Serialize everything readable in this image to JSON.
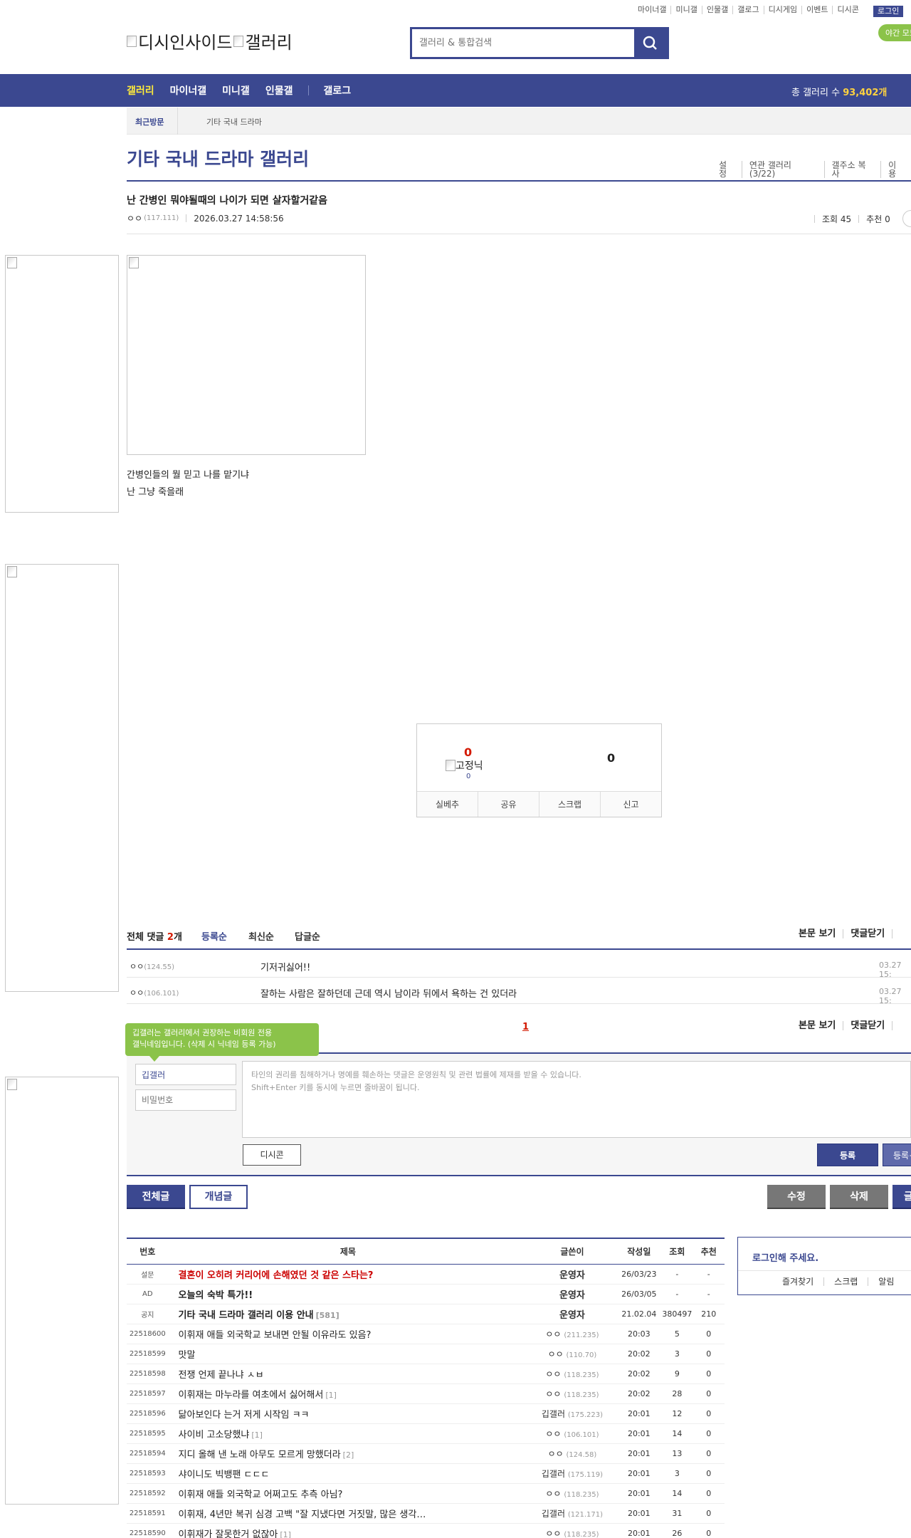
{
  "topnav": {
    "items": [
      "마이너갤",
      "미니갤",
      "인물갤",
      "갤로그",
      "디시게임",
      "이벤트",
      "디시콘"
    ],
    "login_label": "로그인",
    "night_mode_label": "야간 모드"
  },
  "logo": {
    "site_alt": "디시인사이드",
    "gallery_alt": "갤러리"
  },
  "search": {
    "placeholder": "갤러리 & 통합검색"
  },
  "main_nav": {
    "items": [
      "갤러리",
      "마이너갤",
      "미니갤",
      "인물갤",
      "갤로그"
    ],
    "active_index": 0,
    "gallery_count_label": "총 갤러리 수",
    "gallery_count_value": "93,402개"
  },
  "recent": {
    "label": "최근방문",
    "item": "기타 국내 드라마"
  },
  "gallery": {
    "title": "기타 국내 드라마 갤러리",
    "tools": [
      "설정",
      "연관 갤러리(3/22)",
      "갤주소 복사",
      "이용"
    ]
  },
  "post": {
    "title": "난 간병인 뭐야될때의 나이가 되면 살자할거같음",
    "author": "ㅇㅇ",
    "author_ip": "(117.111)",
    "datetime": "2026.03.27 14:58:56",
    "views_label": "조회 45",
    "recommend_label": "추천 0",
    "body_lines": [
      "간병인들의 뭘 믿고 나를 맡기냐",
      "난 그냥 죽을래"
    ]
  },
  "recommend_box": {
    "up_count": "0",
    "fixed_nick_alt": "고정닉",
    "fixed_nick_count": "0",
    "down_count": "0",
    "actions": [
      "실베추",
      "공유",
      "스크랩",
      "신고"
    ]
  },
  "comments": {
    "total_label": "전체 댓글",
    "total_count": "2",
    "total_unit": "개",
    "sorts": [
      "등록순",
      "최신순",
      "답글순"
    ],
    "right_links": [
      "본문 보기",
      "댓글닫기"
    ],
    "items": [
      {
        "nick": "ㅇㅇ",
        "ip": "(124.55)",
        "text": "기저귀싫어!!",
        "date": "03.27 15:"
      },
      {
        "nick": "ㅇㅇ",
        "ip": "(106.101)",
        "text": "잘하는 사람은 잘하던데 근데 역시 남이라 뒤에서 욕하는 건 있더라",
        "date": "03.27 15:"
      }
    ],
    "page": "1"
  },
  "write": {
    "tooltip_line1": "깁갤러는 갤러리에서 권장하는 비회원 전용",
    "tooltip_line2": "갤닉네임입니다. (삭제 시 닉네임 등록 가능)",
    "nick_value": "깁갤러",
    "password_placeholder": "비밀번호",
    "textarea_line1": "타인의 권리를 침해하거나 명예를 훼손하는 댓글은 운영원칙 및 관련 법률에 제재를 받을 수 있습니다.",
    "textarea_line2": "Shift+Enter 키를 동시에 누르면 줄바꿈이 됩니다.",
    "dccon_label": "디시콘",
    "submit_label": "등록",
    "submit2_label": "등록+"
  },
  "list_buttons": {
    "all": "전체글",
    "best": "개념글",
    "edit": "수정",
    "delete": "삭제",
    "write": "글쓰기"
  },
  "list": {
    "headers": [
      "번호",
      "제목",
      "글쓴이",
      "작성일",
      "조회",
      "추천"
    ],
    "rows": [
      {
        "num": "설문",
        "subject": "결혼이 오히려 커리어에 손해였던 것 같은 스타는?",
        "reply": "",
        "writer": "운영자",
        "ip": "",
        "date": "26/03/23",
        "views": "-",
        "rec": "-",
        "style": "red",
        "writer_bold": true
      },
      {
        "num": "AD",
        "subject": "오늘의 숙박 특가!!",
        "reply": "",
        "writer": "운영자",
        "ip": "",
        "date": "26/03/05",
        "views": "-",
        "rec": "-",
        "style": "notice",
        "writer_bold": true
      },
      {
        "num": "공지",
        "subject": "기타 국내 드라마 갤러리 이용 안내",
        "reply": "[581]",
        "writer": "운영자",
        "ip": "",
        "date": "21.02.04",
        "views": "380497",
        "rec": "210",
        "style": "notice",
        "writer_bold": true
      },
      {
        "num": "22518600",
        "subject": "이휘재 애들 외국학교 보내면 안될 이유라도 있음?",
        "reply": "",
        "writer": "ㅇㅇ",
        "ip": "(211.235)",
        "date": "20:03",
        "views": "5",
        "rec": "0",
        "style": "",
        "writer_bold": false
      },
      {
        "num": "22518599",
        "subject": "맛말",
        "reply": "",
        "writer": "ㅇㅇ",
        "ip": "(110.70)",
        "date": "20:02",
        "views": "3",
        "rec": "0",
        "style": "",
        "writer_bold": false
      },
      {
        "num": "22518598",
        "subject": "전쟁 언제 끝나냐 ㅅㅂ",
        "reply": "",
        "writer": "ㅇㅇ",
        "ip": "(118.235)",
        "date": "20:02",
        "views": "9",
        "rec": "0",
        "style": "",
        "writer_bold": false
      },
      {
        "num": "22518597",
        "subject": "이휘재는 마누라를 여초에서 싫어해서",
        "reply": "[1]",
        "writer": "ㅇㅇ",
        "ip": "(118.235)",
        "date": "20:02",
        "views": "28",
        "rec": "0",
        "style": "",
        "writer_bold": false
      },
      {
        "num": "22518596",
        "subject": "닮아보인다 는거 저게 시작임 ㅋㅋ",
        "reply": "",
        "writer": "깁갤러",
        "ip": "(175.223)",
        "date": "20:01",
        "views": "12",
        "rec": "0",
        "style": "",
        "writer_bold": false
      },
      {
        "num": "22518595",
        "subject": "사이비 고소당했냐",
        "reply": "[1]",
        "writer": "ㅇㅇ",
        "ip": "(106.101)",
        "date": "20:01",
        "views": "14",
        "rec": "0",
        "style": "",
        "writer_bold": false
      },
      {
        "num": "22518594",
        "subject": "지디 올해 낸 노래 아무도 모르게 망했더라",
        "reply": "[2]",
        "writer": "ㅇㅇ",
        "ip": "(124.58)",
        "date": "20:01",
        "views": "13",
        "rec": "0",
        "style": "",
        "writer_bold": false
      },
      {
        "num": "22518593",
        "subject": "샤이니도 빅뱅팬 ㄷㄷㄷ",
        "reply": "",
        "writer": "깁갤러",
        "ip": "(175.119)",
        "date": "20:01",
        "views": "3",
        "rec": "0",
        "style": "",
        "writer_bold": false
      },
      {
        "num": "22518592",
        "subject": "이휘재 애들 외국학교 어쩌고도 추측 아님?",
        "reply": "",
        "writer": "ㅇㅇ",
        "ip": "(118.235)",
        "date": "20:01",
        "views": "14",
        "rec": "0",
        "style": "",
        "writer_bold": false
      },
      {
        "num": "22518591",
        "subject": "이휘재, 4년만 복귀 심경 고백 \"잘 지냈다면 거짓말, 많은 생각…",
        "reply": "",
        "writer": "깁갤러",
        "ip": "(121.171)",
        "date": "20:01",
        "views": "31",
        "rec": "0",
        "style": "",
        "writer_bold": false
      },
      {
        "num": "22518590",
        "subject": "이휘재가 잘못한거 없잖아",
        "reply": "[1]",
        "writer": "ㅇㅇ",
        "ip": "(118.235)",
        "date": "20:01",
        "views": "26",
        "rec": "0",
        "style": "",
        "writer_bold": false
      }
    ]
  },
  "login_box": {
    "title": "로그인해 주세요.",
    "links": [
      "즐겨찾기",
      "스크랩",
      "알림"
    ]
  },
  "colors": {
    "brand": "#3b4890",
    "accent_green": "#8bc34a",
    "highlight_red": "#d31900",
    "nav_active": "#ffeb3b"
  }
}
